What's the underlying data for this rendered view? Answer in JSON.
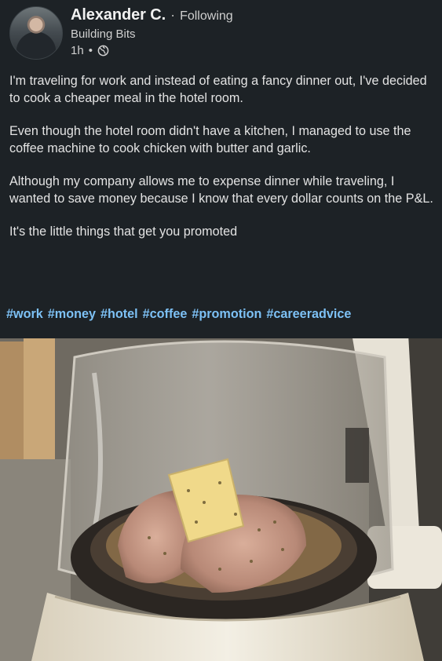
{
  "author": {
    "name": "Alexander C.",
    "separator": "·",
    "follow_status": "Following",
    "subtitle": "Building Bits",
    "time": "1h",
    "time_separator": "•",
    "visibility_icon": "globe-icon"
  },
  "post": {
    "paragraphs": [
      "I'm traveling for work and instead of eating a fancy dinner out, I've decided to cook a cheaper meal in the hotel room.",
      "Even though the hotel room didn't have a kitchen, I managed to use the coffee machine to cook chicken with butter and garlic.",
      "Although my company allows me to expense dinner while traveling, I wanted to save money because I know that every dollar counts on the P&L.",
      "It's the little things that get you promoted"
    ],
    "hashtags": [
      "#work",
      "#money",
      "#hotel",
      "#coffee",
      "#promotion",
      "#careeradvice"
    ]
  },
  "colors": {
    "background": "#1d2226",
    "hashtag": "#7dc1f5",
    "text": "#e3e3e3"
  }
}
